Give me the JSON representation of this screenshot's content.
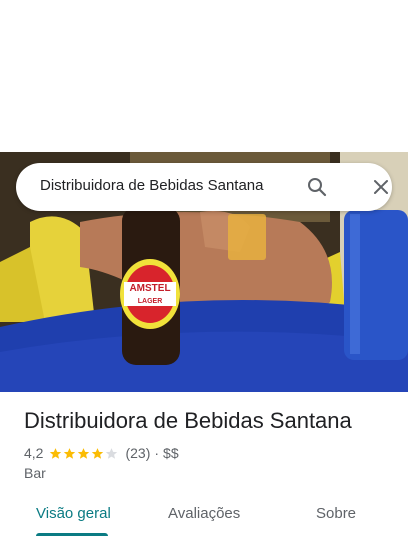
{
  "search": {
    "query": "Distribuidora de Bebidas Santana"
  },
  "place": {
    "name": "Distribuidora de Bebidas Santana",
    "rating": "4,2",
    "stars_filled": 4,
    "stars_total": 5,
    "reviews": "(23)",
    "separator": "·",
    "price": "$$",
    "category": "Bar"
  },
  "tabs": [
    {
      "label": "Visão geral",
      "active": true
    },
    {
      "label": "Avaliações",
      "active": false
    },
    {
      "label": "Sobre",
      "active": false
    }
  ],
  "photo": {
    "bottle_label_brand": "AMSTEL",
    "bottle_label_sub": "LAGER"
  },
  "colors": {
    "accent": "#0a7b83",
    "star": "#fbbc04",
    "star_empty": "#dadce0"
  }
}
